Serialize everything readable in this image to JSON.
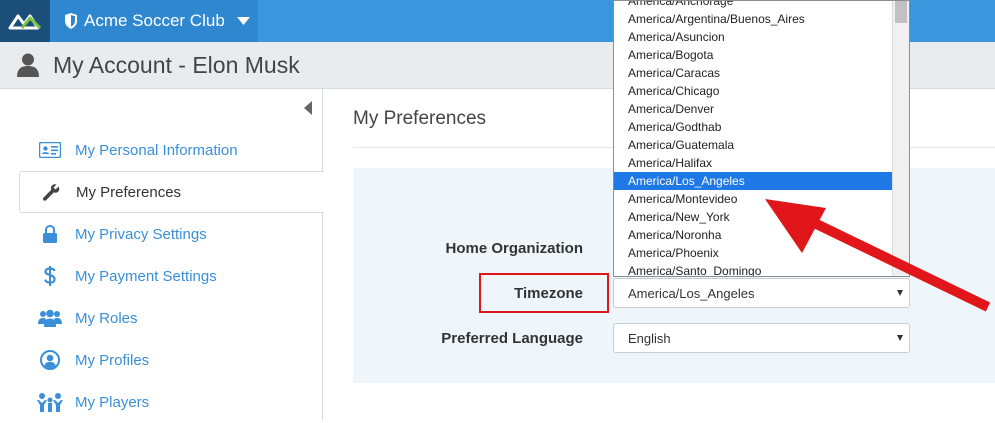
{
  "header": {
    "club_name": "Acme Soccer Club",
    "brand_color": "#3a97dd",
    "logo_icon": "logo-icon",
    "shield_icon": "shield-icon",
    "caret_icon": "caret-down-icon"
  },
  "subheader": {
    "title": "My Account - Elon Musk",
    "icon": "user-icon"
  },
  "sidebar": {
    "items": [
      {
        "label": "My Personal Information",
        "icon": "id-card-icon",
        "active": false
      },
      {
        "label": "My Preferences",
        "icon": "wrench-icon",
        "active": true
      },
      {
        "label": "My Privacy Settings",
        "icon": "lock-icon",
        "active": false
      },
      {
        "label": "My Payment Settings",
        "icon": "dollar-icon",
        "active": false
      },
      {
        "label": "My Roles",
        "icon": "users-icon",
        "active": false
      },
      {
        "label": "My Profiles",
        "icon": "profile-circle-icon",
        "active": false
      },
      {
        "label": "My Players",
        "icon": "players-icon",
        "active": false
      }
    ]
  },
  "main": {
    "title": "My Preferences",
    "form": {
      "home_org_label": "Home Organization",
      "timezone_label": "Timezone",
      "timezone_value": "America/Los_Angeles",
      "language_label": "Preferred Language",
      "language_value": "English"
    }
  },
  "dropdown": {
    "options": [
      "America/Anchorage",
      "America/Argentina/Buenos_Aires",
      "America/Asuncion",
      "America/Bogota",
      "America/Caracas",
      "America/Chicago",
      "America/Denver",
      "America/Godthab",
      "America/Guatemala",
      "America/Halifax",
      "America/Los_Angeles",
      "America/Montevideo",
      "America/New_York",
      "America/Noronha",
      "America/Phoenix",
      "America/Santo_Domingo"
    ],
    "selected": "America/Los_Angeles",
    "highlight_color": "#1e78e6"
  },
  "annotation": {
    "box_color": "#e0161b",
    "arrow_color": "#e0161b"
  }
}
